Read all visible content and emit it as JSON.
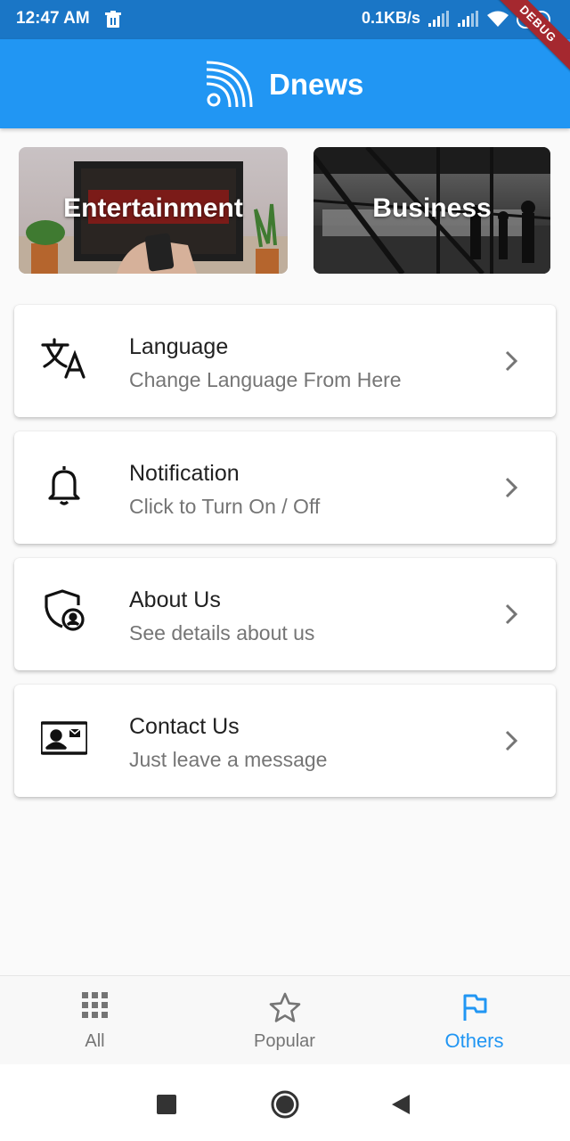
{
  "status_bar": {
    "time": "12:47 AM",
    "speed": "0.1KB/s",
    "battery": "84"
  },
  "debug_banner": "DEBUG",
  "app_bar": {
    "title": "Dnews",
    "logo_icon": "rss-feed-icon"
  },
  "categories": [
    {
      "label": "Entertainment"
    },
    {
      "label": "Business"
    }
  ],
  "settings": [
    {
      "title": "Language",
      "subtitle": "Change Language From Here",
      "icon": "translate-icon"
    },
    {
      "title": "Notification",
      "subtitle": "Click to Turn On / Off",
      "icon": "bell-icon"
    },
    {
      "title": "About Us",
      "subtitle": "See details about us",
      "icon": "shield-user-icon"
    },
    {
      "title": "Contact Us",
      "subtitle": "Just leave a message",
      "icon": "contact-card-icon"
    }
  ],
  "bottom_nav": {
    "items": [
      {
        "label": "All",
        "icon": "grid-icon"
      },
      {
        "label": "Popular",
        "icon": "star-icon"
      },
      {
        "label": "Others",
        "icon": "flag-icon"
      }
    ],
    "active_index": 2
  },
  "colors": {
    "primary": "#2196f3",
    "status_bar": "#1a76c6",
    "debug": "#a5282f",
    "active_nav": "#2196f3",
    "inactive_nav": "#757575"
  }
}
